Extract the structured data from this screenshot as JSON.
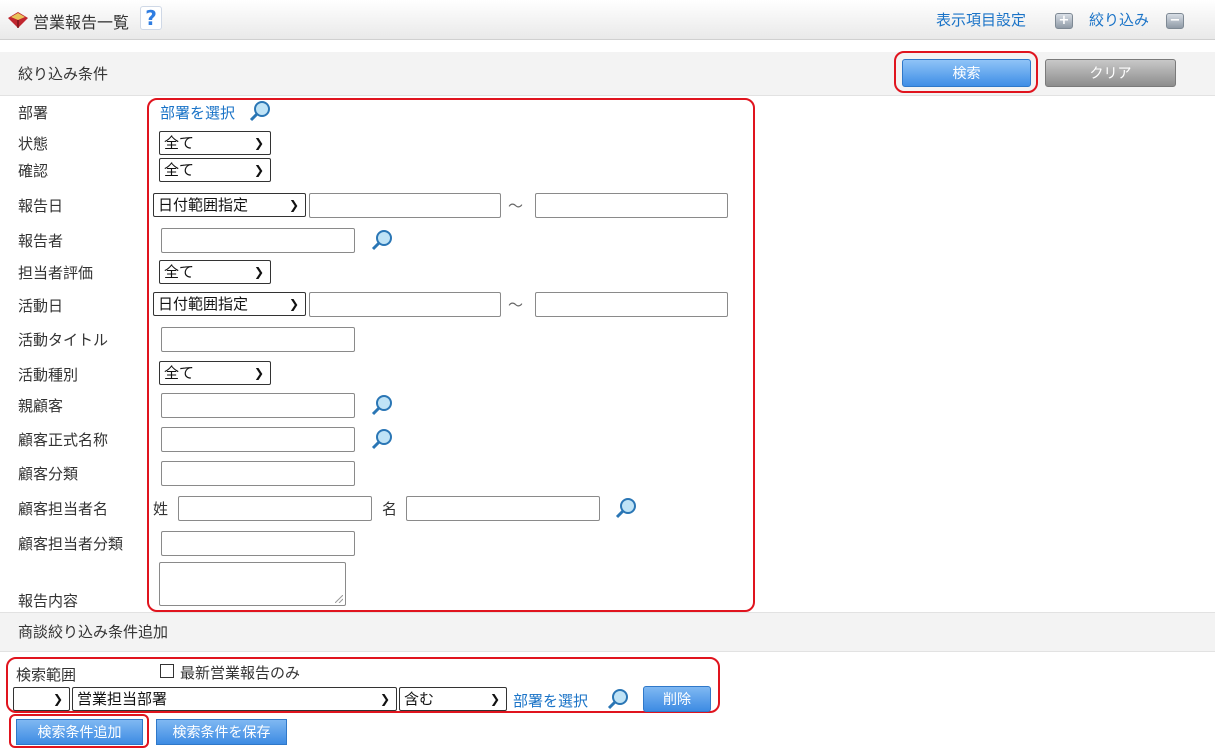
{
  "header": {
    "title": "営業報告一覧",
    "help": "?",
    "display_settings": "表示項目設定",
    "narrow": "絞り込み"
  },
  "filter": {
    "heading": "絞り込み条件",
    "search_button": "検索",
    "clear_button": "クリア",
    "select_dept_link": "部署を選択",
    "range_sep": "～",
    "labels": {
      "department": "部署",
      "status": "状態",
      "confirm": "確認",
      "report_date": "報告日",
      "reporter": "報告者",
      "rating": "担当者評価",
      "activity_date": "活動日",
      "activity_title": "活動タイトル",
      "activity_type": "活動種別",
      "parent_customer": "親顧客",
      "customer_name": "顧客正式名称",
      "customer_category": "顧客分類",
      "contact_name": "顧客担当者名",
      "contact_category": "顧客担当者分類",
      "report_content": "報告内容",
      "last_name": "姓",
      "first_name": "名"
    },
    "values": {
      "status": "全て",
      "confirm": "全て",
      "report_date_mode": "日付範囲指定",
      "rating": "全て",
      "activity_date_mode": "日付範囲指定",
      "activity_type": "全て"
    }
  },
  "deal": {
    "heading": "商談絞り込み条件追加",
    "scope_label": "検索範囲",
    "latest_only": "最新営業報告のみ",
    "field_value": "営業担当部署",
    "operator_value": "含む",
    "select_dept_link": "部署を選択",
    "delete_button": "削除"
  },
  "footer": {
    "add_condition": "検索条件追加",
    "save_condition": "検索条件を保存"
  },
  "colors": {
    "link": "#1a73c7",
    "highlight": "#e0141e",
    "primary_button": "#3f8ee6"
  }
}
